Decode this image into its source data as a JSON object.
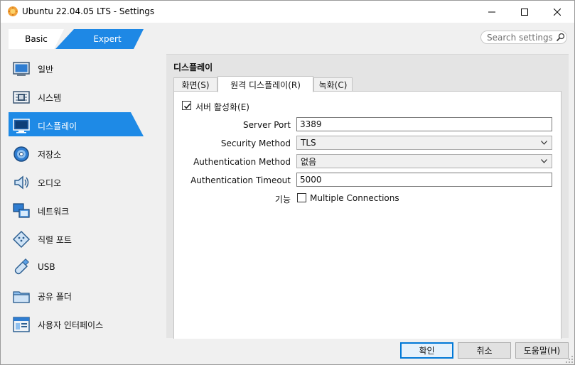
{
  "window": {
    "title": "Ubuntu 22.04.05 LTS - Settings"
  },
  "mode": {
    "basic_label": "Basic",
    "expert_label": "Expert"
  },
  "search": {
    "placeholder": "Search settings"
  },
  "sidebar": {
    "items": [
      {
        "label": "일반",
        "icon": "general-icon"
      },
      {
        "label": "시스템",
        "icon": "system-chip-icon"
      },
      {
        "label": "디스플레이",
        "icon": "display-monitor-icon"
      },
      {
        "label": "저장소",
        "icon": "storage-disk-icon"
      },
      {
        "label": "오디오",
        "icon": "audio-speaker-icon"
      },
      {
        "label": "네트워크",
        "icon": "network-icon"
      },
      {
        "label": "직렬 포트",
        "icon": "serial-port-icon"
      },
      {
        "label": "USB",
        "icon": "usb-icon"
      },
      {
        "label": "공유 폴더",
        "icon": "shared-folder-icon"
      },
      {
        "label": "사용자 인터페이스",
        "icon": "user-interface-icon"
      }
    ],
    "selected_index": 2
  },
  "panel": {
    "title": "디스플레이",
    "tabs": [
      {
        "label": "화면(S)",
        "mnemonic": "S"
      },
      {
        "label": "원격 디스플레이(R)",
        "mnemonic": "R"
      },
      {
        "label": "녹화(C)",
        "mnemonic": "C"
      }
    ],
    "selected_tab": 1
  },
  "remote_display": {
    "enable_server_label": "서버 활성화(E)",
    "enable_server_checked": true,
    "server_port_label": "Server Port",
    "server_port_value": "3389",
    "security_method_label": "Security Method",
    "security_method_value": "TLS",
    "auth_method_label": "Authentication Method",
    "auth_method_value": "없음",
    "auth_timeout_label": "Authentication Timeout",
    "auth_timeout_value": "5000",
    "features_label": "기능",
    "multiple_connections_label": "Multiple Connections",
    "multiple_connections_checked": false
  },
  "buttons": {
    "ok": "확인",
    "cancel": "취소",
    "help": "도움말(H)"
  },
  "colors": {
    "accent": "#1e88e5",
    "selection": "#1e8ae6"
  }
}
